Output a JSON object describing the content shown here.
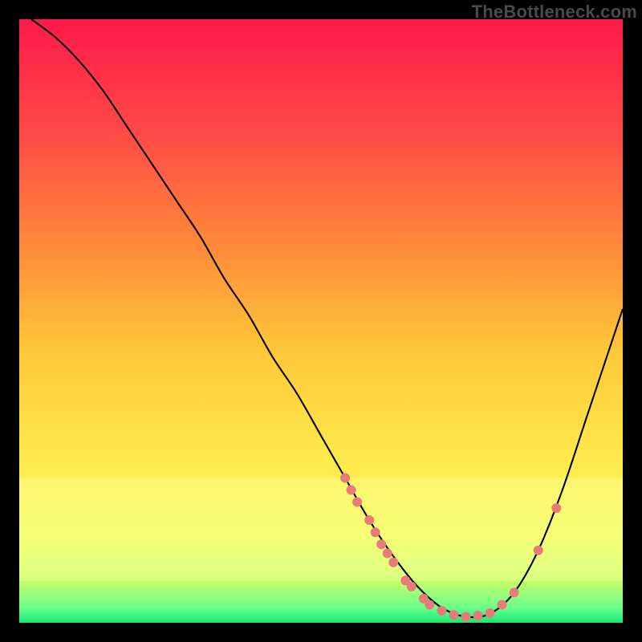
{
  "watermark": "TheBottleneck.com",
  "chart_data": {
    "type": "line",
    "title": "",
    "xlabel": "",
    "ylabel": "",
    "xlim": [
      0,
      100
    ],
    "ylim": [
      0,
      100
    ],
    "background_gradient": {
      "stops": [
        {
          "offset": 0.0,
          "color": "#ff1a4b"
        },
        {
          "offset": 0.18,
          "color": "#ff4747"
        },
        {
          "offset": 0.38,
          "color": "#ff8b3a"
        },
        {
          "offset": 0.55,
          "color": "#ffc838"
        },
        {
          "offset": 0.72,
          "color": "#ffe84a"
        },
        {
          "offset": 0.85,
          "color": "#f4ff55"
        },
        {
          "offset": 0.93,
          "color": "#c6ff6a"
        },
        {
          "offset": 0.975,
          "color": "#6bff8a"
        },
        {
          "offset": 1.0,
          "color": "#18e87a"
        }
      ]
    },
    "pale_band": {
      "y0": 76,
      "y1": 93,
      "color": "#ffffb0",
      "opacity": 0.35
    },
    "series": [
      {
        "name": "curve",
        "color": "#000000",
        "width": 2.1,
        "x": [
          2,
          6,
          10,
          14,
          18,
          22,
          26,
          30,
          34,
          38,
          42,
          46,
          50,
          54,
          58,
          62,
          66,
          70,
          74,
          78,
          82,
          86,
          90,
          94,
          98,
          100
        ],
        "y": [
          100,
          97,
          93,
          88,
          82,
          76,
          70,
          64,
          57,
          51,
          44,
          38,
          31,
          24,
          17,
          11,
          6,
          2.5,
          1,
          1.5,
          5,
          12,
          22,
          34,
          46,
          52
        ]
      }
    ],
    "markers": {
      "color": "#e77b78",
      "radius": 6,
      "points": [
        {
          "x": 54,
          "y": 24
        },
        {
          "x": 55,
          "y": 22
        },
        {
          "x": 56,
          "y": 20
        },
        {
          "x": 58,
          "y": 17
        },
        {
          "x": 59,
          "y": 15
        },
        {
          "x": 60,
          "y": 13
        },
        {
          "x": 61,
          "y": 11.5
        },
        {
          "x": 62,
          "y": 10
        },
        {
          "x": 64,
          "y": 7
        },
        {
          "x": 65,
          "y": 6
        },
        {
          "x": 67,
          "y": 4
        },
        {
          "x": 68,
          "y": 3
        },
        {
          "x": 70,
          "y": 2
        },
        {
          "x": 72,
          "y": 1.3
        },
        {
          "x": 74,
          "y": 1
        },
        {
          "x": 76,
          "y": 1.2
        },
        {
          "x": 78,
          "y": 1.6
        },
        {
          "x": 80,
          "y": 3
        },
        {
          "x": 82,
          "y": 5
        },
        {
          "x": 86,
          "y": 12
        },
        {
          "x": 89,
          "y": 19
        }
      ]
    }
  }
}
